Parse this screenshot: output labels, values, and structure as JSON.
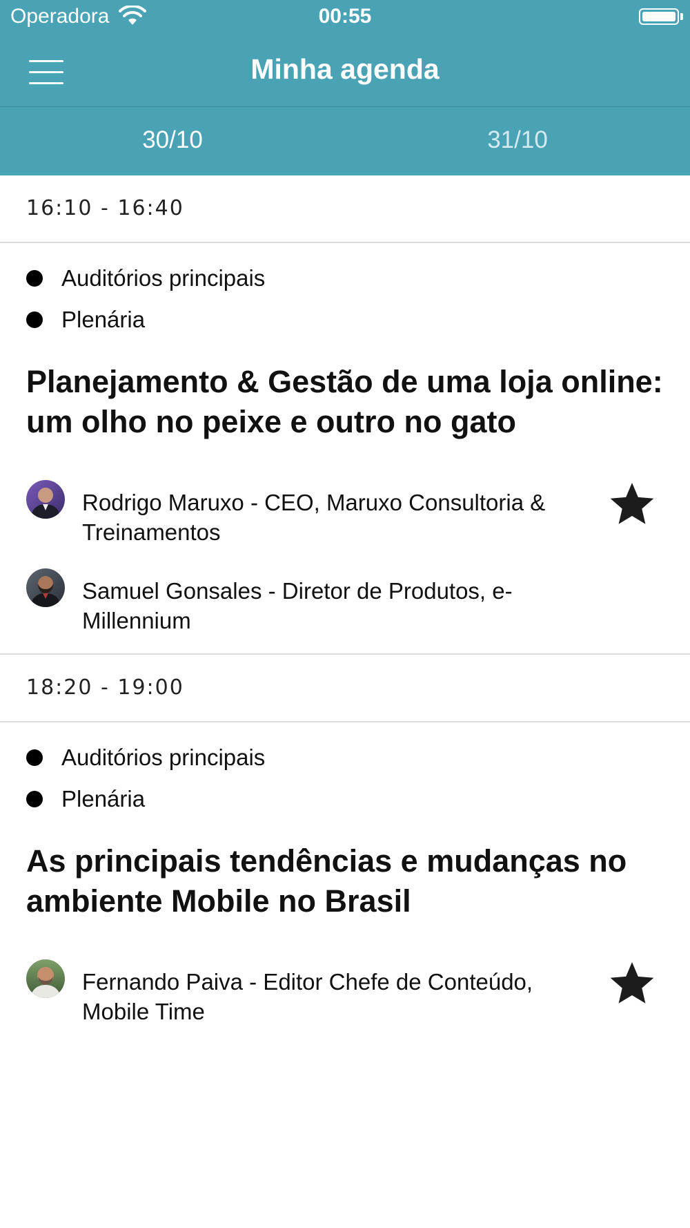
{
  "status_bar": {
    "carrier": "Operadora",
    "time": "00:55"
  },
  "navbar": {
    "title": "Minha agenda"
  },
  "tabs": [
    {
      "label": "30/10",
      "active": true
    },
    {
      "label": "31/10",
      "active": false
    }
  ],
  "sessions": [
    {
      "time": "16:10 - 16:40",
      "tags": [
        "Auditórios principais",
        "Plenária"
      ],
      "title": "Planejamento & Gestão de uma loja online: um olho no peixe e outro no gato",
      "speakers": [
        {
          "text": "Rodrigo Maruxo - CEO, Maruxo Consultoria & Treinamentos",
          "starred": true
        },
        {
          "text": "Samuel Gonsales - Diretor de Produtos, e-Millennium",
          "starred": false
        }
      ]
    },
    {
      "time": "18:20 - 19:00",
      "tags": [
        "Auditórios principais",
        "Plenária"
      ],
      "title": "As principais tendências e mudanças no ambiente Mobile no Brasil",
      "speakers": [
        {
          "text": "Fernando Paiva - Editor Chefe de Conteúdo, Mobile Time",
          "starred": true
        }
      ]
    }
  ],
  "colors": {
    "header": "#4aa3b4",
    "active_tab": "#ffffff",
    "inactive_tab": "#d3ebf0",
    "divider": "#dcdcdc"
  },
  "icons": [
    "wifi-icon",
    "battery-icon",
    "hamburger-menu-icon",
    "bullet-dot-icon",
    "star-icon"
  ]
}
